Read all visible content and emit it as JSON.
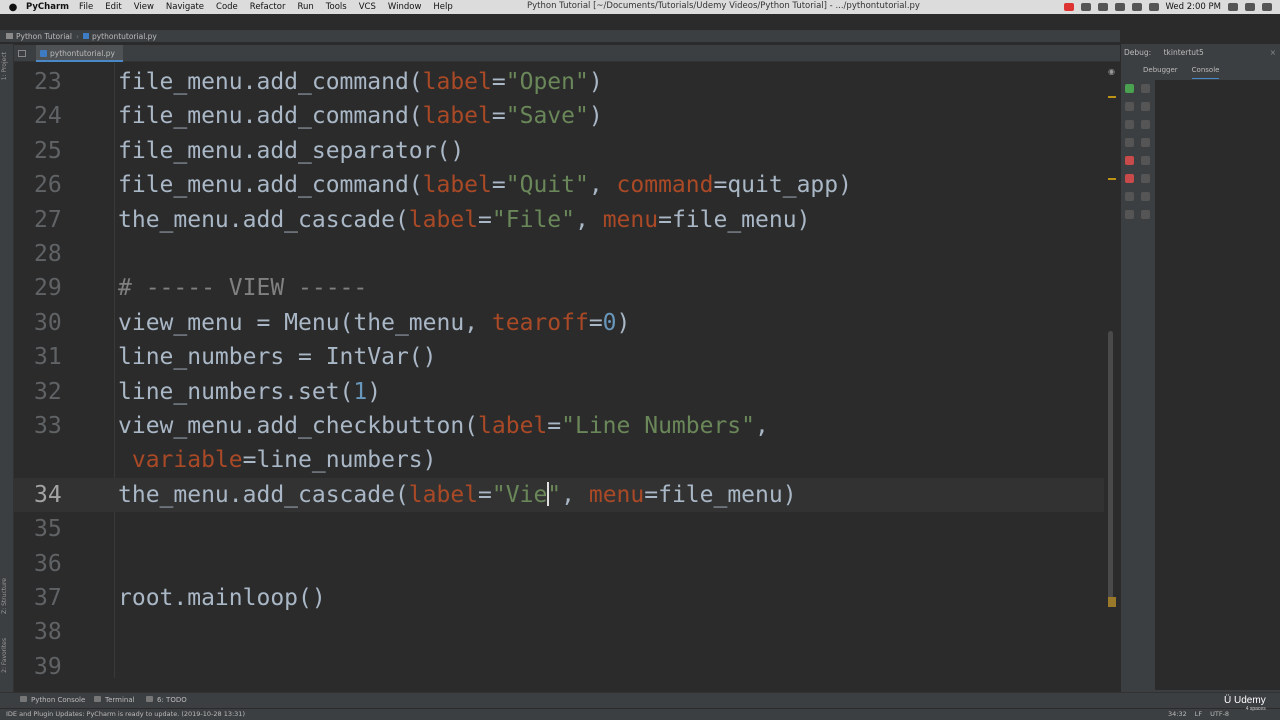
{
  "mac_menu": {
    "app_name": "PyCharm",
    "items": [
      "File",
      "Edit",
      "View",
      "Navigate",
      "Code",
      "Refactor",
      "Run",
      "Tools",
      "VCS",
      "Window",
      "Help"
    ],
    "window_title": "Python Tutorial [~/Documents/Tutorials/Udemy Videos/Python Tutorial] - .../pythontutorial.py",
    "clock": "Wed 2:00 PM"
  },
  "navbar": {
    "project": "Python Tutorial",
    "file": "pythontutorial.py"
  },
  "tabs": [
    {
      "label": "pythontutorial.py",
      "active": true
    }
  ],
  "left_strip": {
    "project_label": "1: Project",
    "structure_label": "Z: Structure",
    "favorites_label": "2: Favorites"
  },
  "editor": {
    "lines": [
      {
        "num": "23",
        "html": "file_menu.add_command(<span class=\"kw\">label</span>=<span class=\"st\">\"Open\"</span>)"
      },
      {
        "num": "24",
        "html": "file_menu.add_command(<span class=\"kw\">label</span>=<span class=\"st\">\"Save\"</span>)"
      },
      {
        "num": "25",
        "html": "file_menu.add_separator()"
      },
      {
        "num": "26",
        "html": "file_menu.add_command(<span class=\"kw\">label</span>=<span class=\"st\">\"Quit\"</span>, <span class=\"kw\">command</span>=quit_app)"
      },
      {
        "num": "27",
        "html": "the_menu.add_cascade(<span class=\"kw\">label</span>=<span class=\"st\">\"File\"</span>, <span class=\"kw\">menu</span>=file_menu)"
      },
      {
        "num": "28",
        "html": ""
      },
      {
        "num": "29",
        "html": "<span class=\"cm\"># ----- VIEW -----</span>"
      },
      {
        "num": "30",
        "html": "view_menu = Menu(the_menu, <span class=\"kw\">tearoff</span>=<span class=\"nu\">0</span>)"
      },
      {
        "num": "31",
        "html": "line_numbers = IntVar()"
      },
      {
        "num": "32",
        "html": "line_numbers.set(<span class=\"nu\">1</span>)"
      },
      {
        "num": "33",
        "html": "view_menu.add_checkbutton(<span class=\"kw\">label</span>=<span class=\"st\">\"Line Numbers\"</span>,"
      },
      {
        "num": "",
        "html": " <span class=\"kw\">variable</span>=line_numbers)"
      },
      {
        "num": "34",
        "html": "the_menu.add_cascade(<span class=\"kw\">label</span>=<span class=\"st\">\"Vie<span class=\"caret\"></span>\"</span>, <span class=\"kw\">menu</span>=file_menu)",
        "current": true
      },
      {
        "num": "35",
        "html": ""
      },
      {
        "num": "36",
        "html": ""
      },
      {
        "num": "37",
        "html": "root.mainloop()"
      },
      {
        "num": "38",
        "html": ""
      },
      {
        "num": "39",
        "html": ""
      }
    ]
  },
  "debug": {
    "label": "Debug:",
    "config": "tkintertut5",
    "tabs": [
      "Debugger",
      "Console"
    ],
    "active_tab": "Console"
  },
  "bottom_tools": [
    "Python Console",
    "Terminal",
    "6: TODO"
  ],
  "status": {
    "message": "IDE and Plugin Updates: PyCharm is ready to update. (2019-10-28 13:31)",
    "position": "34:32",
    "line_sep": "LF",
    "encoding": "UTF-8",
    "indent": "4 spaces"
  },
  "watermark": {
    "brand": "Udemy",
    "sub": "4 spaces"
  }
}
